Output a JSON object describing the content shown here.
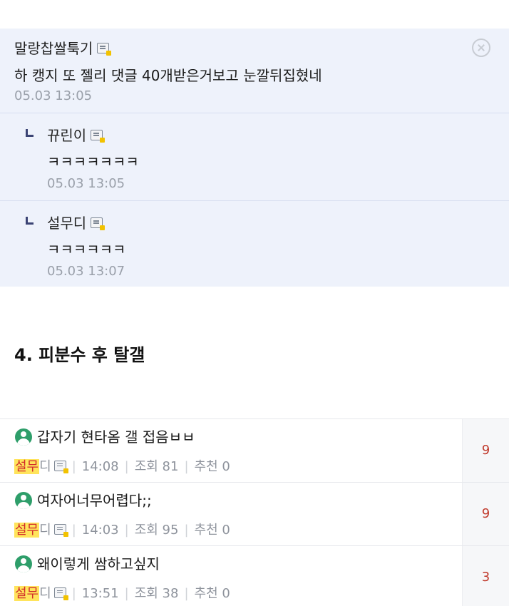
{
  "comments": {
    "main": {
      "nickname": "말랑찹쌀툭기",
      "text": "하 캥지 또 젤리 댓글 40개받은거보고 눈깔뒤집혔네",
      "date": "05.03 13:05"
    },
    "replies": [
      {
        "nickname": "뀨린이",
        "text": "ㅋㅋㅋㅋㅋㅋㅋ",
        "date": "05.03 13:05"
      },
      {
        "nickname": "설무디",
        "text": "ㅋㅋㅋㅋㅋㅋ",
        "date": "05.03 13:07"
      }
    ]
  },
  "section_title": "4. 피분수 후 탈갤",
  "posts": [
    {
      "title": "갑자기 현타옴 갤 접음ㅂㅂ",
      "author_highlight": "설무",
      "author_rest": "디",
      "time": "14:08",
      "views": "조회 81",
      "likes": "추천 0",
      "comments": "9"
    },
    {
      "title": "여자어너무어렵다;;",
      "author_highlight": "설무",
      "author_rest": "디",
      "time": "14:03",
      "views": "조회 95",
      "likes": "추천 0",
      "comments": "9"
    },
    {
      "title": "왜이렇게 쌈하고싶지",
      "author_highlight": "설무",
      "author_rest": "디",
      "time": "13:51",
      "views": "조회 38",
      "likes": "추천 0",
      "comments": "3"
    }
  ],
  "colors": {
    "comment_bg": "#eef2fb",
    "highlight_bg": "#ffe45c",
    "highlight_text": "#d12b2b",
    "count_text": "#c0392b",
    "post_icon": "#2e9e6a"
  },
  "icons": {
    "close": "close-circle-icon",
    "nickname": "fixed-nick-icon",
    "reply": "reply-arrow-icon",
    "post": "image-post-icon"
  }
}
